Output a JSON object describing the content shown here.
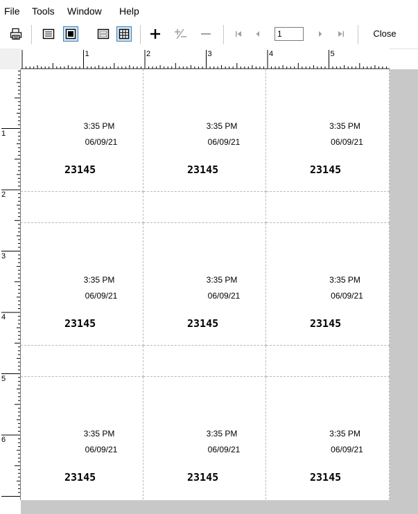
{
  "menu": {
    "items": [
      "File",
      "Tools",
      "Window",
      "Help"
    ]
  },
  "toolbar": {
    "buttons": [
      {
        "name": "print-icon"
      },
      {
        "name": "single-page-icon"
      },
      {
        "name": "fit-page-icon",
        "pressed": true
      },
      {
        "name": "label-grid-icon"
      },
      {
        "name": "table-grid-icon",
        "pressed": true
      },
      {
        "name": "zoom-in-icon"
      },
      {
        "name": "zoom-toggle-icon"
      },
      {
        "name": "zoom-out-icon"
      }
    ],
    "page_number": "1",
    "close_label": "Close"
  },
  "ruler": {
    "horizontal_numbers": [
      "1",
      "2",
      "3",
      "4",
      "5"
    ],
    "vertical_numbers": [
      "1",
      "2",
      "3",
      "4",
      "5",
      "6"
    ]
  },
  "labels": {
    "time": "3:35 PM",
    "date": "06/09/21",
    "code": "23145",
    "rows": 3,
    "cols": 3
  },
  "colors": {
    "dashed_border": "#b8b8b8",
    "workspace_gray": "#c8c8c8",
    "pressed_fill": "#cce4f7",
    "pressed_border": "#3c7fb1"
  }
}
